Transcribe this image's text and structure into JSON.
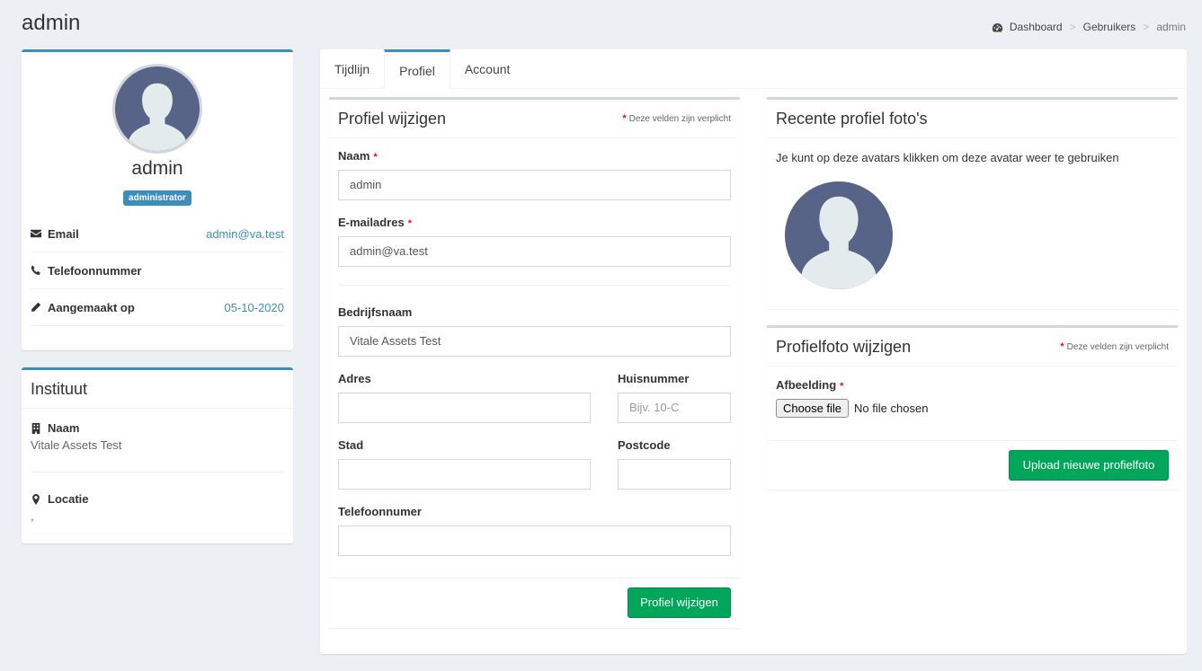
{
  "page": {
    "title": "admin"
  },
  "breadcrumb": {
    "items": [
      "Dashboard",
      "Gebruikers"
    ],
    "current": "admin"
  },
  "profile_card": {
    "name": "admin",
    "role": "administrator",
    "email_label": "Email",
    "email_value": "admin@va.test",
    "phone_label": "Telefoonnummer",
    "created_label": "Aangemaakt op",
    "created_value": "05-10-2020"
  },
  "institute": {
    "title": "Instituut",
    "name_label": "Naam",
    "name_value": "Vitale Assets Test",
    "location_label": "Locatie",
    "location_value": ","
  },
  "tabs": [
    {
      "label": "Tijdlijn"
    },
    {
      "label": "Profiel"
    },
    {
      "label": "Account"
    }
  ],
  "edit_profile": {
    "title": "Profiel wijzigen",
    "required_note": "Deze velden zijn verplicht",
    "name_label": "Naam",
    "name_value": "admin",
    "email_label": "E-mailadres",
    "email_value": "admin@va.test",
    "company_label": "Bedrijfsnaam",
    "company_value": "Vitale Assets Test",
    "address_label": "Adres",
    "address_value": "",
    "house_label": "Huisnummer",
    "house_placeholder": "Bijv. 10-C",
    "city_label": "Stad",
    "city_value": "",
    "postcode_label": "Postcode",
    "postcode_value": "",
    "phone_label": "Telefoonnumer",
    "phone_value": "",
    "submit_label": "Profiel wijzigen"
  },
  "recent_photos": {
    "title": "Recente profiel foto's",
    "hint": "Je kunt op deze avatars klikken om deze avatar weer te gebruiken"
  },
  "change_photo": {
    "title": "Profielfoto wijzigen",
    "required_note": "Deze velden zijn verplicht",
    "image_label": "Afbeelding",
    "choose_label": "Choose file",
    "file_status": "No file chosen",
    "upload_label": "Upload nieuwe profielfoto"
  },
  "colors": {
    "accent": "#3c8dbc",
    "success": "#00a65a",
    "required": "#dd1111",
    "background": "#ecf0f5",
    "avatar_bg": "#576387",
    "avatar_fg": "#e4ebec"
  },
  "required_marker": "*",
  "icons": [
    "dashboard-icon",
    "envelope-icon",
    "phone-icon",
    "pencil-icon",
    "building-icon",
    "map-marker-icon",
    "asterisk-icon"
  ]
}
